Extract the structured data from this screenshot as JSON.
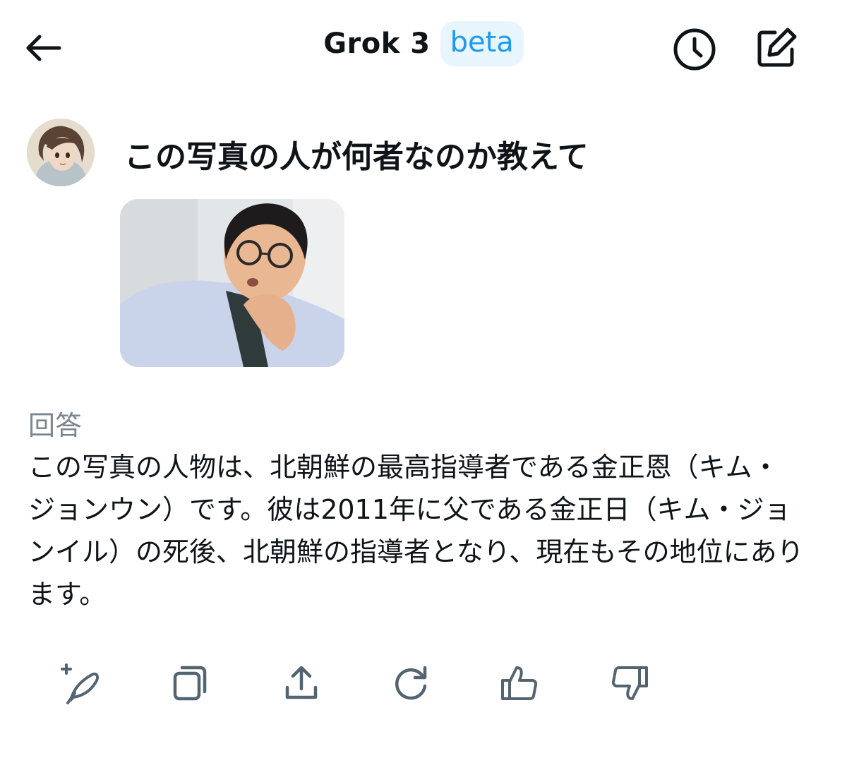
{
  "header": {
    "title": "Grok 3",
    "badge": "beta",
    "back_icon": "arrow-left-icon",
    "history_icon": "clock-icon",
    "compose_icon": "compose-icon"
  },
  "conversation": {
    "user_question": "この写真の人が何者なのか教えて",
    "answer_label": "回答",
    "answer_text": "この写真の人物は、北朝鮮の最高指導者である金正恩（キム・ジョンウン）です。彼は2011年に父である金正日（キム・ジョンイル）の死後、北朝鮮の指導者となり、現在もその地位にあります。"
  },
  "actions": [
    {
      "icon": "sparkle-feather-icon"
    },
    {
      "icon": "copy-icon"
    },
    {
      "icon": "share-icon"
    },
    {
      "icon": "regenerate-icon"
    },
    {
      "icon": "thumbs-up-icon"
    },
    {
      "icon": "thumbs-down-icon"
    }
  ],
  "colors": {
    "accent": "#1d9bf0",
    "badge_bg": "#e8f5fd",
    "text": "#0f1419",
    "muted": "#7a8590",
    "icon": "#536471"
  }
}
